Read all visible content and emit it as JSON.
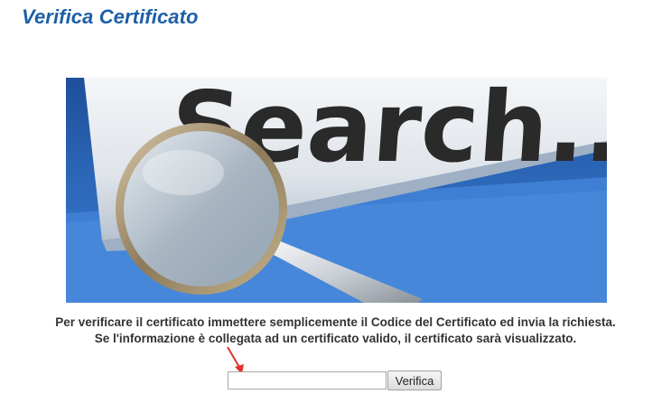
{
  "page": {
    "title": "Verifica Certificato"
  },
  "hero": {
    "image_text": "Search..."
  },
  "instructions": {
    "line1": "Per verificare il certificato immettere semplicemente il Codice del Certificato ed invia la richiesta.",
    "line2": "Se l'informazione è collegata ad un certificato valido, il certificato sarà visualizzato."
  },
  "form": {
    "code_value": "",
    "verify_label": "Verifica"
  },
  "colors": {
    "title": "#1d5fa8",
    "hero_blue": "#2c67b8",
    "arrow": "#e0322e"
  }
}
